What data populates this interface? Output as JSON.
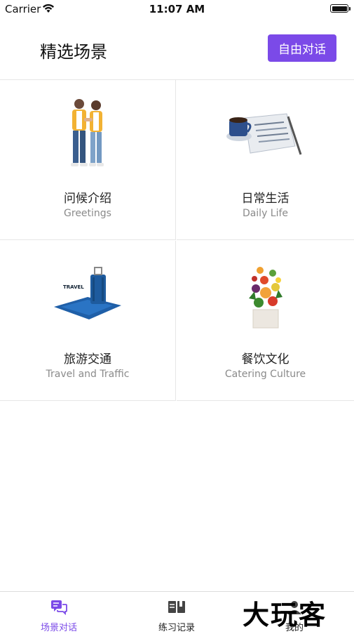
{
  "status_bar": {
    "carrier": "Carrier",
    "time": "11:07 AM"
  },
  "header": {
    "title": "精选场景",
    "free_chat_label": "自由对话"
  },
  "scenes": [
    {
      "title": "问候介绍",
      "subtitle": "Greetings",
      "icon": "couple-illustration"
    },
    {
      "title": "日常生活",
      "subtitle": "Daily Life",
      "icon": "coffee-newspaper-illustration"
    },
    {
      "title": "旅游交通",
      "subtitle": "Travel and Traffic",
      "icon": "suitcase-illustration",
      "badge": "TRAVEL"
    },
    {
      "title": "餐饮文化",
      "subtitle": "Catering Culture",
      "icon": "food-bag-illustration"
    }
  ],
  "tabbar": {
    "items": [
      {
        "label": "场景对话",
        "icon": "chat-icon",
        "active": true
      },
      {
        "label": "练习记录",
        "icon": "book-icon",
        "active": false
      },
      {
        "label": "我的",
        "icon": "profile-icon",
        "active": false
      }
    ]
  },
  "watermark": "大玩客",
  "colors": {
    "accent": "#7b4ae8",
    "divider": "#e6e6e6",
    "subtitle": "#8a8a8a"
  }
}
